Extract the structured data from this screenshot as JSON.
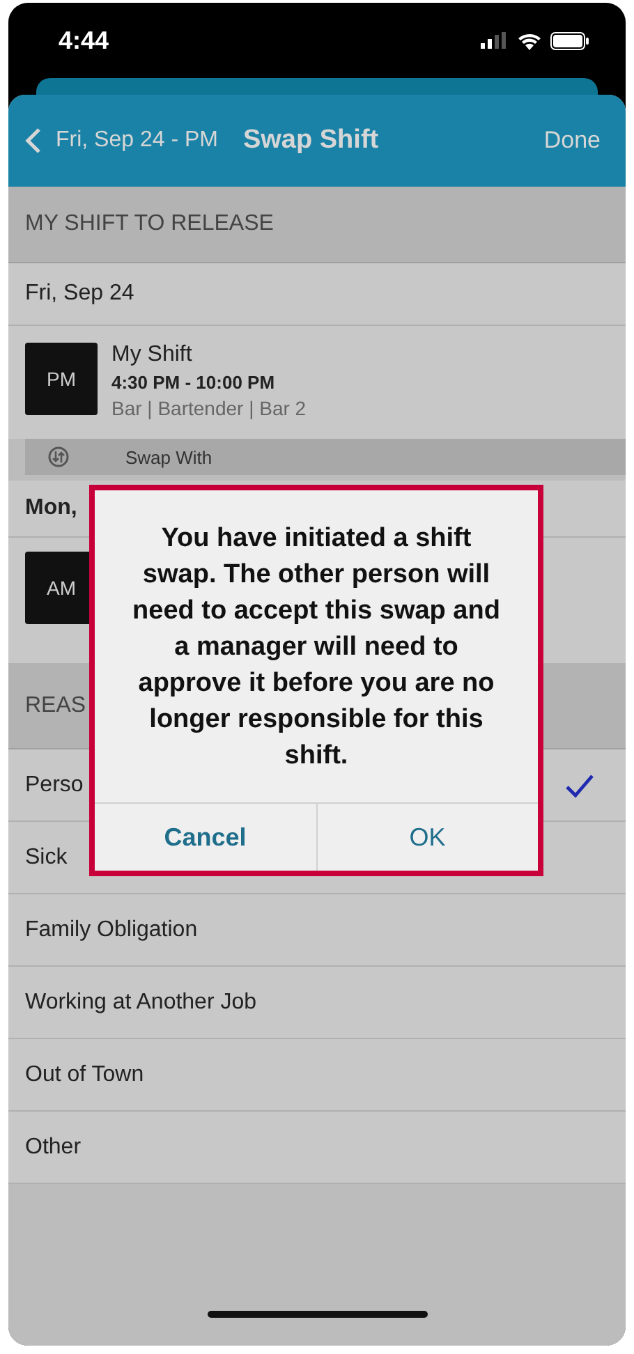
{
  "status_bar": {
    "time": "4:44"
  },
  "nav": {
    "back_label": "Fri, Sep 24 - PM",
    "title": "Swap Shift",
    "action": "Done"
  },
  "release_section": {
    "header": "MY SHIFT TO RELEASE",
    "date": "Fri, Sep 24",
    "shift": {
      "badge": "PM",
      "name": "My Shift",
      "time": "4:30 PM - 10:00 PM",
      "details": "Bar | Bartender | Bar 2"
    }
  },
  "swap_bar": {
    "label": "Swap With"
  },
  "swap_section": {
    "date": "Mon,",
    "shift": {
      "badge": "AM"
    }
  },
  "reason_section": {
    "header": "REAS",
    "items": [
      {
        "label": "Perso",
        "selected": true
      },
      {
        "label": "Sick",
        "selected": false
      },
      {
        "label": "Family Obligation",
        "selected": false
      },
      {
        "label": "Working at Another Job",
        "selected": false
      },
      {
        "label": "Out of Town",
        "selected": false
      },
      {
        "label": "Other",
        "selected": false
      }
    ]
  },
  "dialog": {
    "message": "You have initiated a shift swap. The other person will need to accept this swap and a manager will need to approve it before you are no longer responsible for this shift.",
    "buttons": [
      "Cancel",
      "OK"
    ]
  }
}
